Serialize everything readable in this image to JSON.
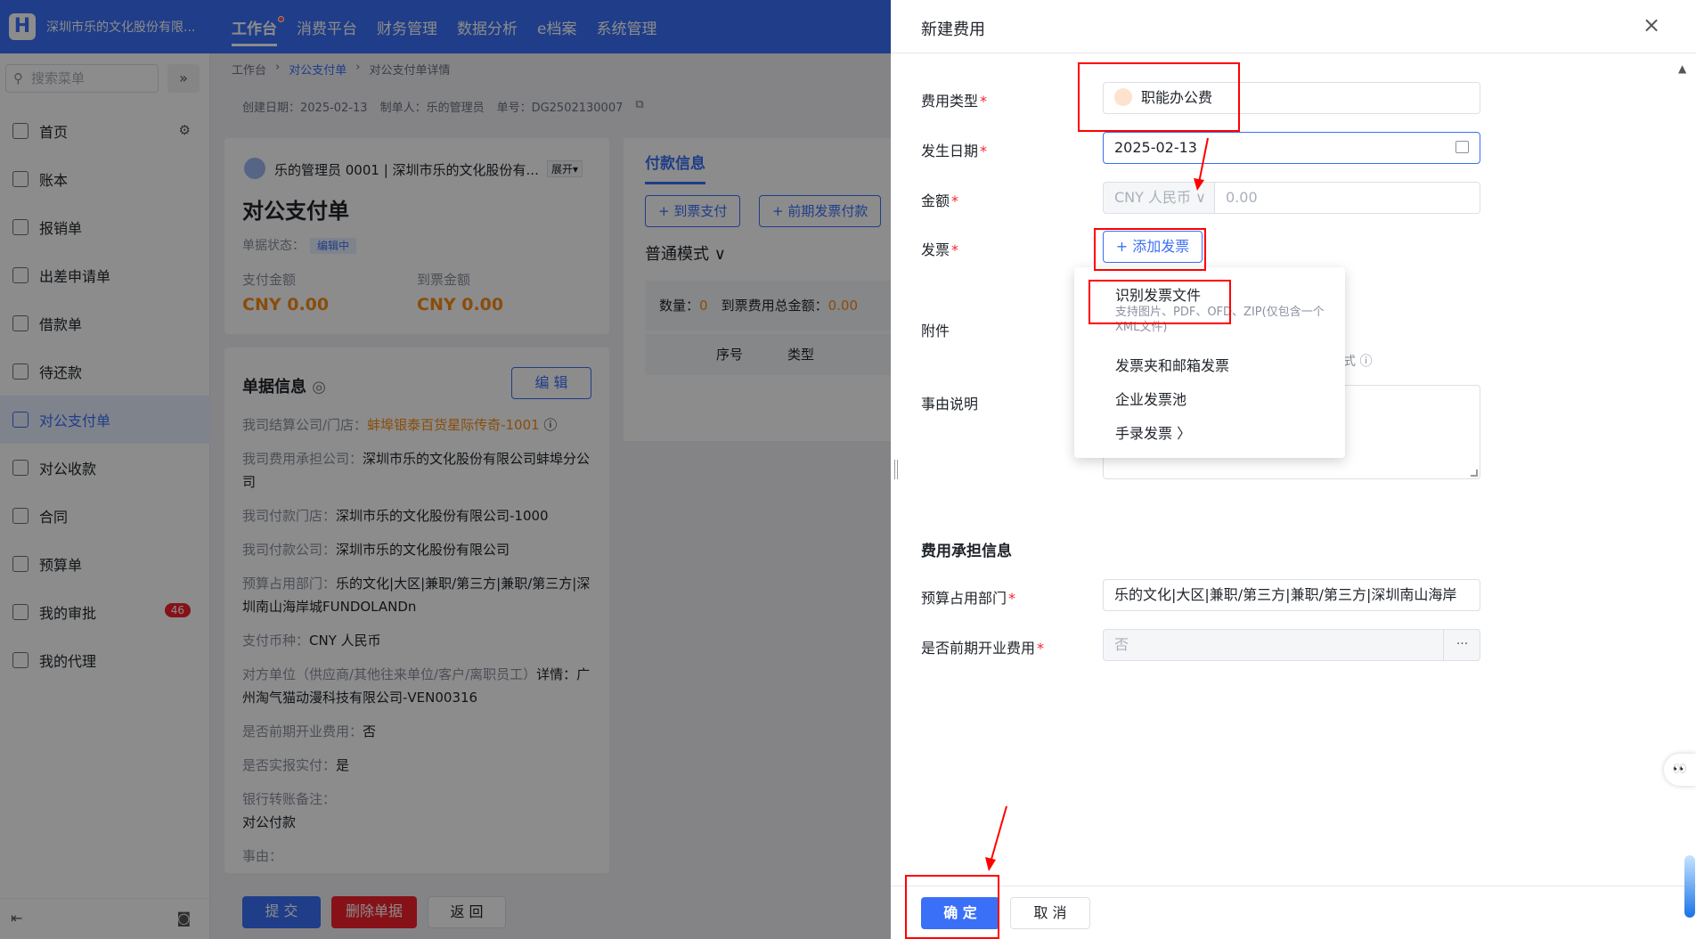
{
  "app": {
    "logo_letter": "H",
    "org_name": "深圳市乐的文化股份有限...",
    "nav": [
      "工作台",
      "消费平台",
      "财务管理",
      "数据分析",
      "e档案",
      "系统管理"
    ]
  },
  "sidebar": {
    "search_placeholder": "搜索菜单",
    "collapse_glyph": "»",
    "items": [
      {
        "label": "首页"
      },
      {
        "label": "账本"
      },
      {
        "label": "报销单"
      },
      {
        "label": "出差申请单"
      },
      {
        "label": "借款单"
      },
      {
        "label": "待还款"
      },
      {
        "label": "对公支付单"
      },
      {
        "label": "对公收款"
      },
      {
        "label": "合同"
      },
      {
        "label": "预算单"
      },
      {
        "label": "我的审批",
        "badge": "46"
      },
      {
        "label": "我的代理"
      }
    ]
  },
  "breadcrumb": [
    "工作台",
    "对公支付单",
    "对公支付单详情"
  ],
  "meta": {
    "created": "创建日期：2025-02-13",
    "maker": "制单人：乐的管理员",
    "number": "单号：DG2502130007"
  },
  "doc_card": {
    "who": "乐的管理员 0001 | 深圳市乐的文化股份有...",
    "expand": "展开▾",
    "title": "对公支付单",
    "state_label": "单据状态：",
    "state_tag": "编辑中",
    "pay_label": "支付金额",
    "pay_value": "CNY 0.00",
    "inv_label": "到票金额",
    "inv_value": "CNY 0.00"
  },
  "info_card": {
    "heading": "单据信息",
    "edit": "编 辑",
    "rows": [
      {
        "k": "我司结算公司/门店：",
        "v": "蚌埠银泰百货星际传奇-1001"
      },
      {
        "k": "我司费用承担公司：",
        "v": "深圳市乐的文化股份有限公司蚌埠分公司"
      },
      {
        "k": "我司付款门店：",
        "v": "深圳市乐的文化股份有限公司-1000"
      },
      {
        "k": "我司付款公司：",
        "v": "深圳市乐的文化股份有限公司"
      },
      {
        "k": "预算占用部门：",
        "v": "乐的文化|大区|兼职/第三方|兼职/第三方|深圳南山海岸城FUNDOLANDn"
      },
      {
        "k": "支付币种：",
        "v": "CNY 人民币"
      },
      {
        "k": "对方单位（供应商/其他往来单位/客户/离职员工）",
        "v": "详情：广州淘气猫动漫科技有限公司-VEN00316"
      },
      {
        "k": "是否前期开业费用：",
        "v": "否"
      },
      {
        "k": "是否实报实付：",
        "v": "是"
      },
      {
        "k": "银行转账备注：",
        "v": "对公付款"
      },
      {
        "k": "事由：",
        "v": ""
      }
    ]
  },
  "pay_card": {
    "tab": "付款信息",
    "btn1": "+ 到票支付",
    "btn2": "+ 前期发票付款",
    "mode": "普通模式 ∨",
    "sum_label1": "数量：",
    "sum_value1": "0",
    "sum_label2": "到票费用总金额：",
    "sum_value2": "0.00",
    "th_index": "序号",
    "th_type": "类型"
  },
  "page_footer": {
    "submit": "提 交",
    "delete": "删除单据",
    "back": "返 回"
  },
  "drawer": {
    "title": "新建费用",
    "close": "×",
    "fields": {
      "fee_type_label": "费用类型",
      "fee_type_value": "职能办公费",
      "date_label": "发生日期",
      "date_value": "2025-02-13",
      "amount_label": "金额",
      "currency": "CNY 人民币 ∨",
      "amount_placeholder": "0.00",
      "invoice_label": "发票",
      "add_invoice": "+ 添加发票",
      "attachment_label": "附件",
      "attachment_hint": "式 ⓘ",
      "reason_label": "事由说明",
      "section_title": "费用承担信息",
      "budget_label": "预算占用部门",
      "budget_value": "乐的文化|大区|兼职/第三方|兼职/第三方|深圳南山海岸",
      "preopen_label": "是否前期开业费用",
      "preopen_value": "否",
      "more": "···"
    },
    "dropdown": {
      "opt1": "识别发票文件",
      "opt1_sub": "支持图片、PDF、OFD、ZIP(仅包含一个XML文件)",
      "opt2": "发票夹和邮箱发票",
      "opt3": "企业发票池",
      "opt4": "手录发票 〉"
    },
    "ok": "确 定",
    "cancel": "取 消"
  },
  "float_bot": "👀"
}
